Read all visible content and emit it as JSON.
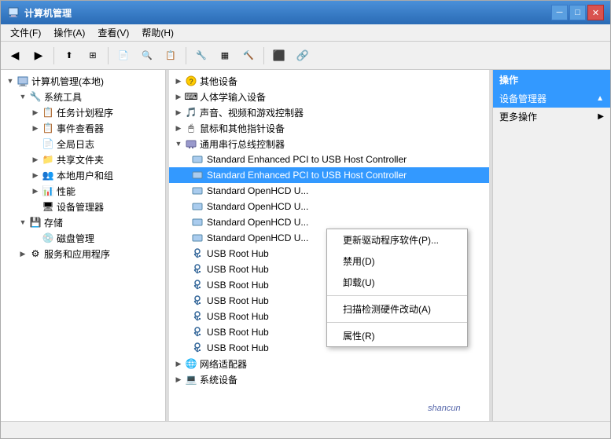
{
  "window": {
    "title": "计算机管理",
    "titleIcon": "💻"
  },
  "menubar": {
    "items": [
      "文件(F)",
      "操作(A)",
      "查看(V)",
      "帮助(H)"
    ]
  },
  "toolbar": {
    "buttons": [
      "◀",
      "▶",
      "↑",
      "⊞",
      "📄",
      "🔍",
      "⚙",
      "▦",
      "📋",
      "🔧",
      "🔨"
    ]
  },
  "left_tree": {
    "root": {
      "label": "计算机管理(本地)",
      "icon": "💻"
    },
    "items": [
      {
        "label": "系统工具",
        "level": 1,
        "expanded": true,
        "icon": "🔧"
      },
      {
        "label": "任务计划程序",
        "level": 2,
        "icon": "📋"
      },
      {
        "label": "事件查看器",
        "level": 2,
        "icon": "📋"
      },
      {
        "label": "全局日志",
        "level": 2,
        "icon": "📄"
      },
      {
        "label": "共享文件夹",
        "level": 2,
        "icon": "📁"
      },
      {
        "label": "本地用户和组",
        "level": 2,
        "icon": "👥"
      },
      {
        "label": "性能",
        "level": 2,
        "icon": "📊"
      },
      {
        "label": "设备管理器",
        "level": 2,
        "icon": "🖥"
      },
      {
        "label": "存储",
        "level": 1,
        "expanded": true,
        "icon": "💾"
      },
      {
        "label": "磁盘管理",
        "level": 2,
        "icon": "💿"
      },
      {
        "label": "服务和应用程序",
        "level": 1,
        "icon": "⚙"
      }
    ]
  },
  "device_tree": {
    "categories": [
      {
        "label": "其他设备",
        "level": 0,
        "icon": "❓",
        "expanded": false
      },
      {
        "label": "人体学输入设备",
        "level": 0,
        "icon": "⌨",
        "expanded": false
      },
      {
        "label": "声音、视频和游戏控制器",
        "level": 0,
        "icon": "🎵",
        "expanded": false
      },
      {
        "label": "鼠标和其他指针设备",
        "level": 0,
        "icon": "🖱",
        "expanded": false
      },
      {
        "label": "通用串行总线控制器",
        "level": 0,
        "icon": "🔌",
        "expanded": true
      },
      {
        "label": "Standard Enhanced PCI to USB Host Controller",
        "level": 1,
        "icon": "🖥"
      },
      {
        "label": "Standard Enhanced PCI to USB Host Controller",
        "level": 1,
        "icon": "🖥",
        "contextSelected": true
      },
      {
        "label": "Standard OpenHCD U...",
        "level": 1,
        "icon": "🖥"
      },
      {
        "label": "Standard OpenHCD U...",
        "level": 1,
        "icon": "🖥"
      },
      {
        "label": "Standard OpenHCD U...",
        "level": 1,
        "icon": "🖥"
      },
      {
        "label": "Standard OpenHCD U...",
        "level": 1,
        "icon": "🖥"
      },
      {
        "label": "USB Root Hub",
        "level": 1,
        "icon": "🔌"
      },
      {
        "label": "USB Root Hub",
        "level": 1,
        "icon": "🔌"
      },
      {
        "label": "USB Root Hub",
        "level": 1,
        "icon": "🔌"
      },
      {
        "label": "USB Root Hub",
        "level": 1,
        "icon": "🔌"
      },
      {
        "label": "USB Root Hub",
        "level": 1,
        "icon": "🔌"
      },
      {
        "label": "USB Root Hub",
        "level": 1,
        "icon": "🔌"
      },
      {
        "label": "USB Root Hub",
        "level": 1,
        "icon": "🔌"
      },
      {
        "label": "网络适配器",
        "level": 0,
        "icon": "🌐",
        "expanded": false
      },
      {
        "label": "系统设备",
        "level": 0,
        "icon": "💻",
        "expanded": false
      }
    ]
  },
  "right_panel": {
    "header": "操作",
    "items": [
      {
        "label": "设备管理器",
        "hasArrow": true,
        "selected": true
      },
      {
        "label": "更多操作",
        "hasArrow": true
      }
    ]
  },
  "context_menu": {
    "items": [
      {
        "label": "更新驱动程序软件(P)...",
        "separator_after": false
      },
      {
        "label": "禁用(D)",
        "separator_after": false
      },
      {
        "label": "卸载(U)",
        "separator_after": true
      },
      {
        "label": "扫描检测硬件改动(A)",
        "separator_after": true
      },
      {
        "label": "属性(R)",
        "separator_after": false
      }
    ]
  },
  "watermark": "shancun"
}
